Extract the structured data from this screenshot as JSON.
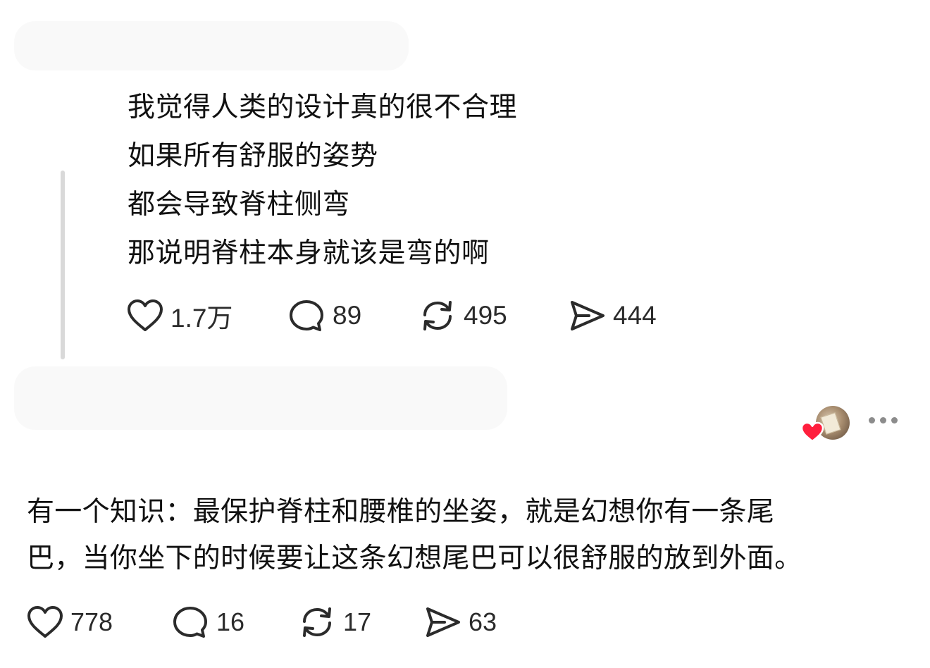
{
  "post1": {
    "lines": [
      "我觉得人类的设计真的很不合理",
      "如果所有舒服的姿势",
      "都会导致脊柱侧弯",
      "那说明脊柱本身就该是弯的啊"
    ],
    "actions": {
      "likes": "1.7万",
      "comments": "89",
      "reposts": "495",
      "shares": "444"
    }
  },
  "post2": {
    "lines": [
      "有一个知识：最保护脊柱和腰椎的坐姿，就是幻想你有一条尾",
      "巴，当你坐下的时候要让这条幻想尾巴可以很舒服的放到外面。"
    ],
    "actions": {
      "likes": "778",
      "comments": "16",
      "reposts": "17",
      "shares": "63"
    }
  },
  "icons": {
    "like": "heart-outline-icon",
    "comment": "speech-bubble-icon",
    "repost": "repost-arrows-icon",
    "share": "paper-plane-icon",
    "liked_badge": "red-heart-icon",
    "more": "more-dots-icon"
  },
  "colors": {
    "text": "#111111",
    "count": "#2b2b2b",
    "liked_heart": "#ff1f3d",
    "thread_line": "#d9d9d9"
  }
}
